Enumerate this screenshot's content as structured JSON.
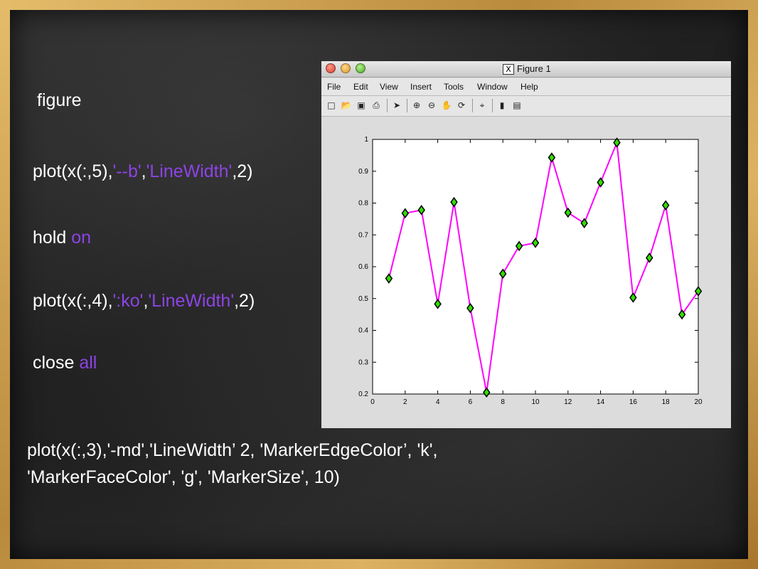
{
  "slide": {
    "code": {
      "figure": "figure",
      "line1_pre": "plot(x(:,5),",
      "line1_s1": "'--b'",
      "line1_mid": ",",
      "line1_s2": "'LineWidth'",
      "line1_post": ",2)",
      "hold": "hold",
      "hold_arg": "on",
      "line2_pre": "plot(x(:,4),",
      "line2_s1": "':ko'",
      "line2_mid": ",",
      "line2_s2": "'LineWidth'",
      "line2_post": ",2)",
      "close": "close",
      "close_arg": "all",
      "bottom_line1": "plot(x(:,3),'-md','LineWidth’ 2, 'MarkerEdgeColor’,  'k',",
      "bottom_line2": "'MarkerFaceColor', 'g', 'MarkerSize', 10)"
    },
    "colors": {
      "keyword": "#8d43e6",
      "text": "#ffffff"
    }
  },
  "figure_window": {
    "title": "Figure 1",
    "menu": [
      "File",
      "Edit",
      "View",
      "Insert",
      "Tools",
      "Window",
      "Help"
    ],
    "toolbar_icons": [
      "new-file-icon",
      "open-folder-icon",
      "save-icon",
      "print-icon",
      "pointer-icon",
      "zoom-in-icon",
      "zoom-out-icon",
      "pan-hand-icon",
      "rotate-3d-icon",
      "data-cursor-icon",
      "colorbar-icon",
      "legend-icon"
    ]
  },
  "chart_data": {
    "type": "line",
    "x": [
      1,
      2,
      3,
      4,
      5,
      6,
      7,
      8,
      9,
      10,
      11,
      12,
      13,
      14,
      15,
      16,
      17,
      18,
      19,
      20
    ],
    "series": [
      {
        "values": [
          0.563,
          0.768,
          0.778,
          0.483,
          0.803,
          0.47,
          0.205,
          0.578,
          0.665,
          0.675,
          0.943,
          0.77,
          0.737,
          0.865,
          0.99,
          0.503,
          0.628,
          0.793,
          0.45,
          0.523
        ],
        "line_color": "#ff00ff",
        "marker": "diamond",
        "marker_face": "#33dd00",
        "marker_edge": "#000000"
      }
    ],
    "xlim": [
      0,
      20
    ],
    "ylim": [
      0.2,
      1.0
    ],
    "xticks": [
      0,
      2,
      4,
      6,
      8,
      10,
      12,
      14,
      16,
      18,
      20
    ],
    "yticks": [
      0.2,
      0.3,
      0.4,
      0.5,
      0.6,
      0.7,
      0.8,
      0.9,
      1
    ],
    "grid": false
  }
}
